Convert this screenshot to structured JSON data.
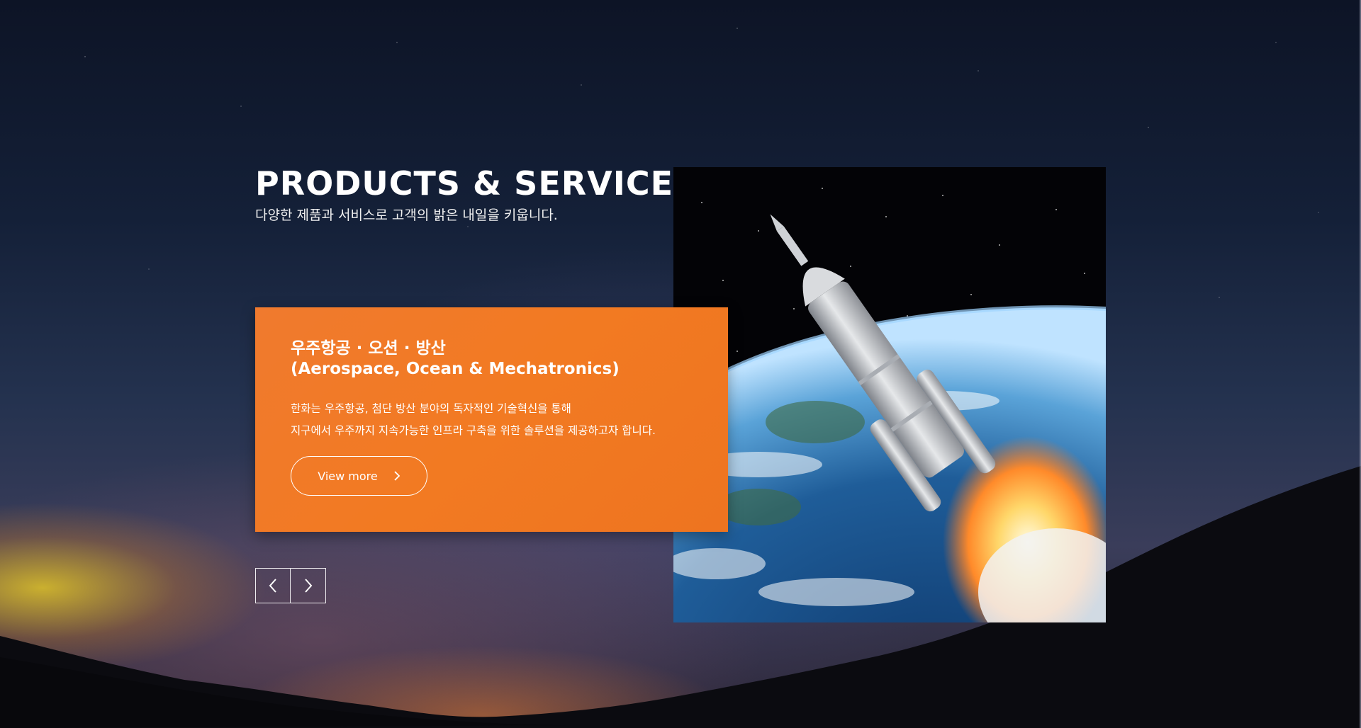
{
  "section": {
    "title": "PRODUCTS & SERVICES",
    "subtitle": "다양한 제품과 서비스로 고객의 밝은 내일을 키웁니다."
  },
  "card": {
    "title_ko": "우주항공 · 오션 · 방산",
    "title_en": "(Aerospace, Ocean & Mechatronics)",
    "desc_line1": "한화는 우주항공, 첨단 방산 분야의 독자적인 기술혁신을 통해",
    "desc_line2": "지구에서 우주까지 지속가능한 인프라 구축을 위한 솔루션을 제공하고자 합니다.",
    "button_label": "View more",
    "button_icon": "chevron-right-icon",
    "accent_color": "#F27A22"
  },
  "photo": {
    "subject_icon": "rocket-launch-image"
  },
  "slider_nav": {
    "prev_icon": "chevron-left-icon",
    "next_icon": "chevron-right-icon"
  }
}
